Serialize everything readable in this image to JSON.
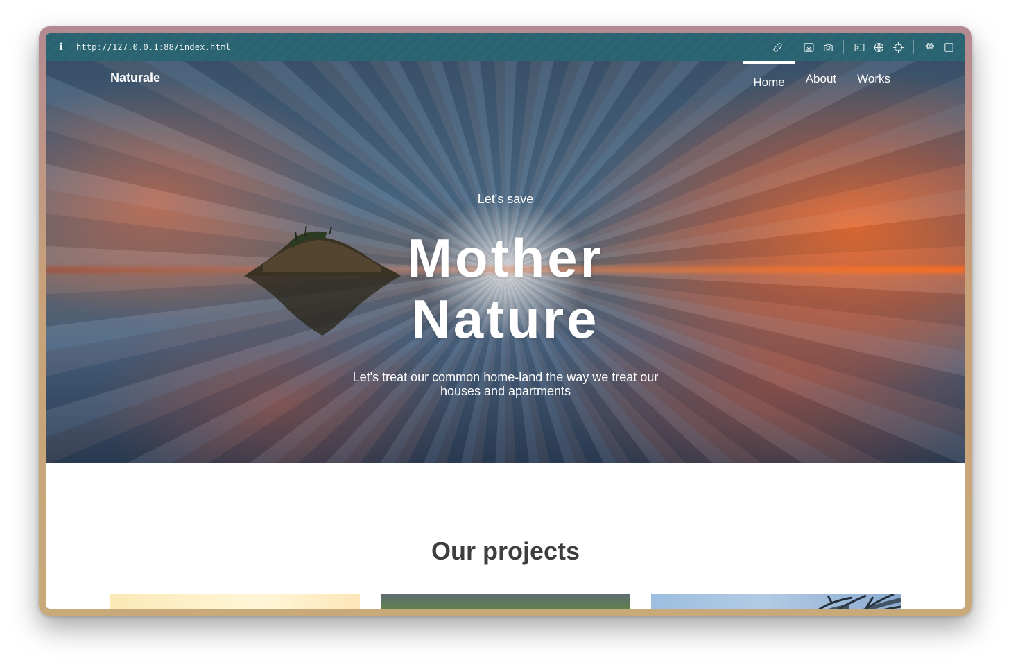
{
  "browser": {
    "url": "http://127.0.0.1:88/index.html",
    "info_glyph": "i",
    "toolbar_icons": [
      "link-icon",
      "download-icon",
      "camera-icon",
      "terminal-icon",
      "globe-icon",
      "crosshair-icon",
      "extensions-icon",
      "split-view-icon"
    ]
  },
  "nav": {
    "brand": "Naturale",
    "items": [
      {
        "label": "Home",
        "active": true
      },
      {
        "label": "About",
        "active": false
      },
      {
        "label": "Works",
        "active": false
      }
    ]
  },
  "hero": {
    "pretitle": "Let's save",
    "title_line1": "Mother",
    "title_line2": "Nature",
    "subtitle_line1": "Let's treat our common home-land the way we treat our",
    "subtitle_line2": "houses and apartments"
  },
  "projects": {
    "heading": "Our projects"
  },
  "colors": {
    "toolbar_bg": "#2c6674",
    "heading_text": "#3e3e3e",
    "hero_text": "#ffffff"
  }
}
